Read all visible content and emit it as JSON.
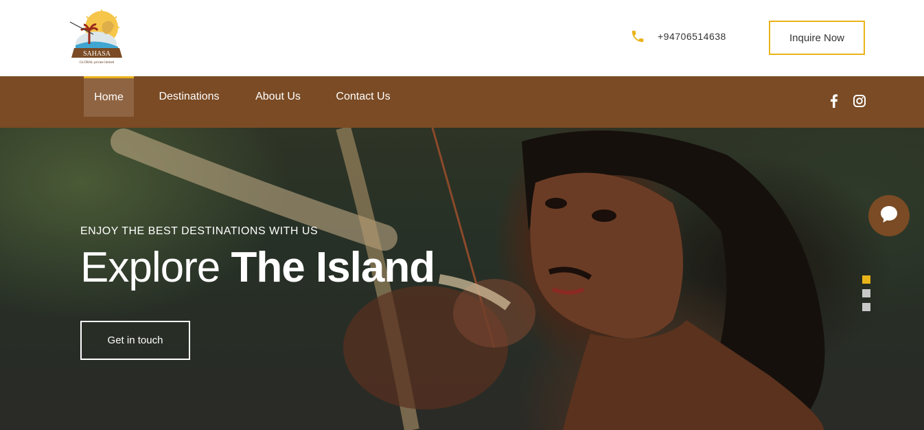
{
  "header": {
    "logo_text": "SAHASA",
    "logo_subtext": "GLOBAL private limited",
    "phone": "+94706514638",
    "inquire_label": "Inquire Now"
  },
  "nav": {
    "items": [
      {
        "label": "Home",
        "active": true
      },
      {
        "label": "Destinations",
        "active": false
      },
      {
        "label": "About Us",
        "active": false
      },
      {
        "label": "Contact Us",
        "active": false
      }
    ],
    "social": [
      "facebook-icon",
      "instagram-icon"
    ]
  },
  "hero": {
    "subtitle": "ENJOY THE BEST DESTINATIONS WITH US",
    "title_light": "Explore",
    "title_bold": "The Island",
    "cta_label": "Get in touch"
  },
  "slider": {
    "total": 3,
    "active_index": 0
  },
  "colors": {
    "accent": "#e9b31a",
    "brown": "#7a4b24",
    "nav_active_bg": "#8f6442"
  }
}
